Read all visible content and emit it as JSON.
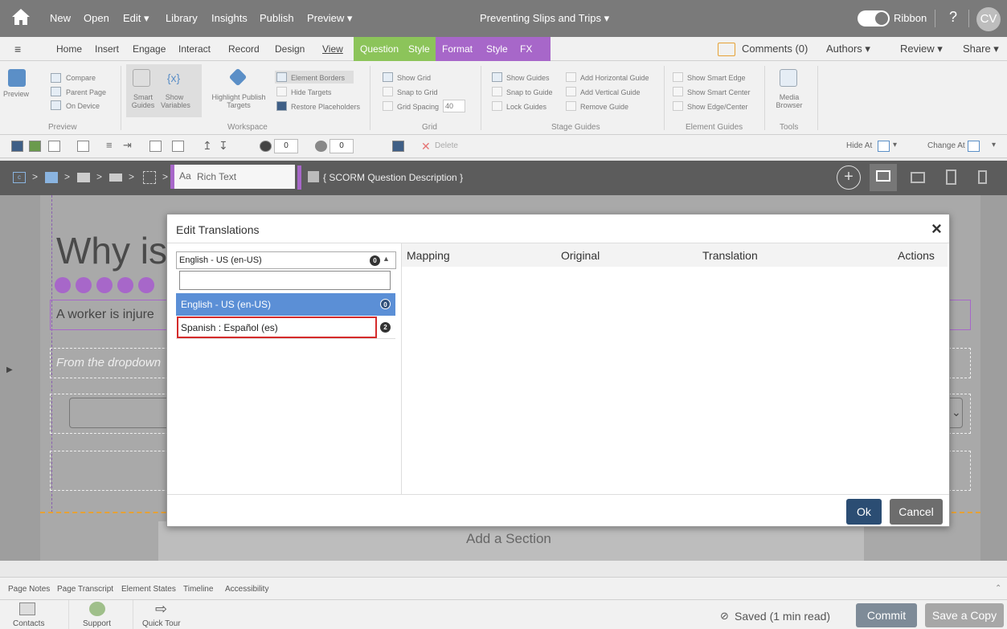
{
  "topbar": {
    "menu": [
      "New",
      "Open",
      "Edit ▾",
      "Library",
      "Insights",
      "Publish",
      "Preview ▾"
    ],
    "title": "Preventing Slips and Trips",
    "title_caret": "▾",
    "ribbon_label": "Ribbon",
    "help": "?",
    "avatar": "CV"
  },
  "tabs": {
    "home": "Home",
    "insert": "Insert",
    "engage": "Engage",
    "interact": "Interact",
    "record": "Record",
    "design": "Design",
    "view": "View",
    "question": "Question",
    "style1": "Style",
    "format": "Format",
    "style2": "Style",
    "fx": "FX",
    "comments": "Comments (0)",
    "authors": "Authors ▾",
    "review": "Review ▾",
    "share": "Share ▾"
  },
  "ribbon": {
    "preview": {
      "big": "Preview",
      "compare": "Compare",
      "parent": "Parent Page",
      "device": "On Device",
      "label": "Preview"
    },
    "workspace": {
      "smart": "Smart Guides",
      "show_vars": "Show Variables",
      "highlight": "Highlight Publish Targets",
      "borders": "Element Borders",
      "hide_targets": "Hide Targets",
      "restore": "Restore Placeholders",
      "label": "Workspace"
    },
    "grid": {
      "show": "Show Grid",
      "snap": "Snap to Grid",
      "spacing": "Grid Spacing",
      "spacing_val": "40",
      "label": "Grid"
    },
    "stage": {
      "show": "Show Guides",
      "snap": "Snap to Guide",
      "lock": "Lock Guides",
      "add_h": "Add Horizontal Guide",
      "add_v": "Add Vertical Guide",
      "remove": "Remove Guide",
      "label": "Stage Guides"
    },
    "element_guides": {
      "edge": "Show Smart Edge",
      "center": "Show Smart Center",
      "edge_center": "Show Edge/Center",
      "label": "Element Guides"
    },
    "tools": {
      "media": "Media Browser",
      "label": "Tools"
    }
  },
  "toolbar2": {
    "val1": "0",
    "val2": "0",
    "delete": "Delete",
    "hide_at": "Hide At",
    "change_at": "Change At"
  },
  "crumb": {
    "rich_text": "Rich Text",
    "scorm": "{ SCORM Question Description }"
  },
  "canvas": {
    "heading": "Why is",
    "worker": "A worker is injure",
    "dropdown_hint": "From the dropdown",
    "add_section": "Add a Section"
  },
  "modal": {
    "title": "Edit Translations",
    "close": "×",
    "selected_language": "English - US (en-US)",
    "selected_count": "0",
    "filter_placeholder": "",
    "options": [
      {
        "label": "English - US (en-US)",
        "count": "0"
      },
      {
        "label": "Spanish : Español (es)",
        "count": "2"
      }
    ],
    "columns": {
      "mapping": "Mapping",
      "original": "Original",
      "translation": "Translation",
      "actions": "Actions"
    },
    "ok": "Ok",
    "cancel": "Cancel"
  },
  "bottom_tabs": [
    "Page Notes",
    "Page Transcript",
    "Element States",
    "Timeline",
    "Accessibility"
  ],
  "bottom": {
    "contacts": "Contacts",
    "support": "Support",
    "tour": "Quick Tour",
    "saved": "Saved (1 min read)",
    "commit": "Commit",
    "save_copy": "Save a Copy"
  }
}
